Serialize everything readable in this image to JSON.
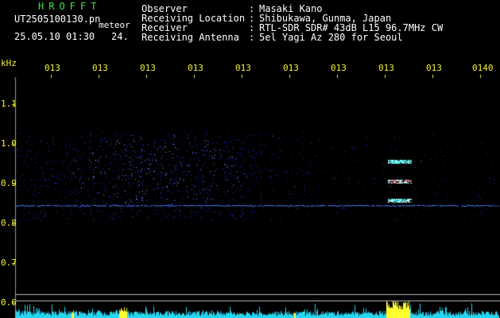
{
  "header": {
    "title": "HROFFT",
    "filename": "UT2505100130.pn",
    "label": "meteor",
    "datetime": "25.05.10 01:30",
    "number": "24.",
    "info": [
      {
        "key": "Observer",
        "value": "Masaki Kano"
      },
      {
        "key": "Receiving Location",
        "value": "Shibukawa, Gunma, Japan"
      },
      {
        "key": "Receiver",
        "value": "RTL-SDR SDR# 43dB L15 96.7MHz CW"
      },
      {
        "key": "Receiving Antenna",
        "value": "5el Yagi Az 280 for Seoul"
      }
    ],
    "colon": ":"
  },
  "chart_data": {
    "type": "heatmap",
    "ylabel": "kHz",
    "xticks": [
      "013",
      "013",
      "013",
      "013",
      "013",
      "013",
      "013",
      "013",
      "013",
      "0140"
    ],
    "yticks": [
      "1.1",
      "1.0",
      "0.9",
      "0.8",
      "0.7",
      "0.6"
    ],
    "ylim": [
      0.6,
      1.15
    ],
    "colors": {
      "noise": "#1c3cff",
      "echo_hot": "#ff3030",
      "echo_mid": "#4cf0f0",
      "spectrum": "#25d6f0",
      "spectrum_peak": "#ffff30",
      "label_green": "#43e04a",
      "label_yellow": "#f2f23a"
    }
  }
}
